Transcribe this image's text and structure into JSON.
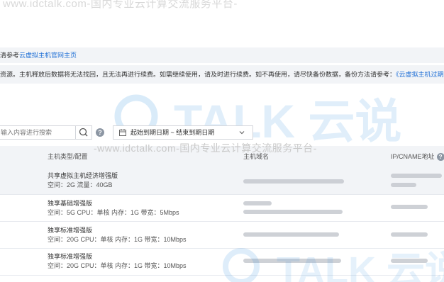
{
  "watermark": {
    "top": "www.idctalk.com-国内专业云计算交流服务平台-",
    "middle": "-www.idctalk.com-国内专业云计算交流服务平台-",
    "logo": "TALK 云说",
    "logo_color": "#2f8fe0"
  },
  "reference": {
    "prefix": "清参考",
    "link": "云虚拟主机官网主页"
  },
  "notice": {
    "text": "资源。主机释放后数据将无法找回，且无法再进行续费。如需继续使用，请及时进行续费。如不再使用，请尽快备份数据，备份方法请参考：",
    "link": "《云虚拟主机过期后备份》"
  },
  "search": {
    "placeholder": "输入内容进行搜索",
    "icon": "search-icon"
  },
  "date_filter": {
    "label": "起始到期日期 ~ 结束到期日期",
    "icon": "calendar-icon",
    "chevron": "chevron-down-icon"
  },
  "table": {
    "headers": {
      "type": "主机类型/配置",
      "domain": "主机域名",
      "ip": "IP/CNAME地址"
    },
    "rows": [
      {
        "type": "共享虚拟主机经济增强版",
        "config": "空间：2G 流量：40GB"
      },
      {
        "type": "独享基础增强版",
        "config": "空间：5G CPU：单核 内存：1G 带宽：5Mbps"
      },
      {
        "type": "独享标准增强版",
        "config": "空间：20G CPU：单核 内存：1G 带宽：10Mbps"
      },
      {
        "type": "独享标准增强版",
        "config": "空间：20G CPU：单核 内存：1G 带宽：10Mbps"
      }
    ]
  },
  "colors": {
    "accent": "#1f6fd6",
    "header_bg": "#f2f4f7"
  }
}
